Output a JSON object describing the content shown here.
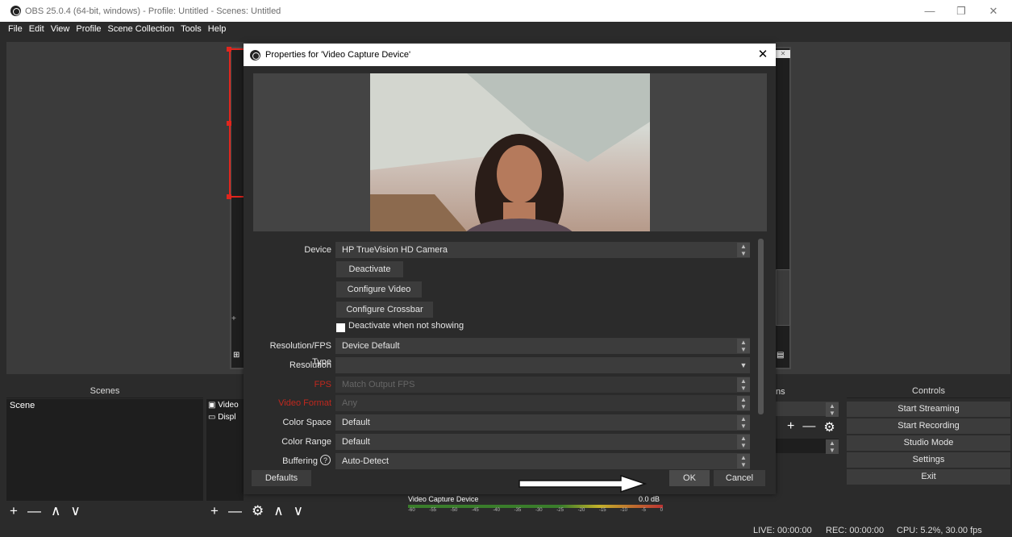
{
  "window": {
    "title": "OBS 25.0.4 (64-bit, windows) - Profile: Untitled - Scenes: Untitled",
    "minimize": "—",
    "restore": "❐",
    "close": "✕"
  },
  "menu": [
    "File",
    "Edit",
    "View",
    "Profile",
    "Scene Collection",
    "Tools",
    "Help"
  ],
  "scenes_dock": {
    "title": "Scenes",
    "items": [
      "Scene"
    ],
    "toolbar": [
      "+",
      "—",
      "∧",
      "∨"
    ]
  },
  "sources_dock": {
    "items": [
      "Video",
      "Displ"
    ],
    "toolbar": [
      "+",
      "—",
      "⚙",
      "∧",
      "∨"
    ]
  },
  "transitions_dock": {
    "title_fragment": "ns"
  },
  "controls_dock": {
    "title": "Controls",
    "buttons": [
      "Start Streaming",
      "Start Recording",
      "Studio Mode",
      "Settings",
      "Exit"
    ]
  },
  "mixer": {
    "source": "Video Capture Device",
    "level": "0.0 dB",
    "ticks": [
      "-60",
      "-55",
      "-50",
      "-45",
      "-40",
      "-35",
      "-30",
      "-25",
      "-20",
      "-15",
      "-10",
      "-5",
      "0"
    ]
  },
  "status": {
    "live": "LIVE: 00:00:00",
    "rec": "REC: 00:00:00",
    "cpu": "CPU: 5.2%, 30.00 fps"
  },
  "dialog": {
    "title": "Properties for 'Video Capture Device'",
    "close": "✕",
    "props": {
      "device_label": "Device",
      "device_value": "HP TrueVision HD Camera",
      "deactivate": "Deactivate",
      "configure_video": "Configure Video",
      "configure_crossbar": "Configure Crossbar",
      "deactivate_not_showing": "Deactivate when not showing",
      "res_fps_label": "Resolution/FPS Type",
      "res_fps_value": "Device Default",
      "resolution_label": "Resolution",
      "resolution_value": "",
      "fps_label": "FPS",
      "fps_value": "Match Output FPS",
      "video_format_label": "Video Format",
      "video_format_value": "Any",
      "color_space_label": "Color Space",
      "color_space_value": "Default",
      "color_range_label": "Color Range",
      "color_range_value": "Default",
      "buffering_label": "Buffering",
      "buffering_value": "Auto-Detect"
    },
    "defaults": "Defaults",
    "ok": "OK",
    "cancel": "Cancel"
  },
  "colors": {
    "background": "#2b2b2b",
    "panel": "#1e1e1e",
    "button": "#3c3c3c",
    "selection_red": "#e0261e",
    "disabled_label_red": "#c0281e"
  }
}
